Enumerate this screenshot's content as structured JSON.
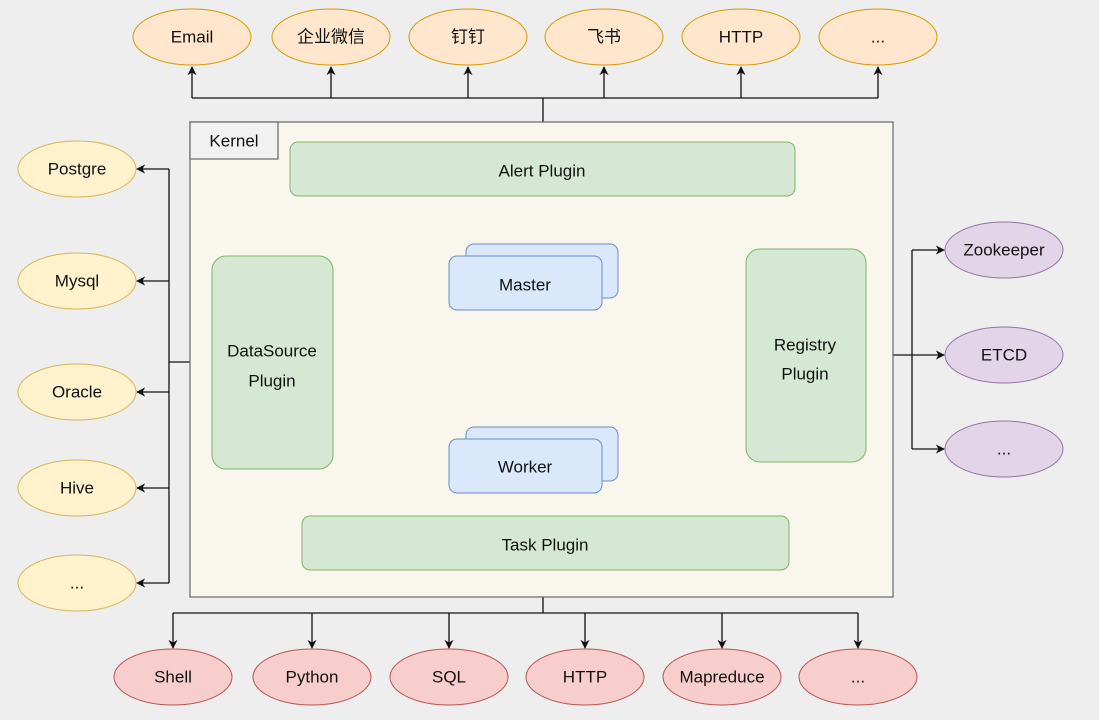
{
  "kernel": {
    "label": "Kernel"
  },
  "plugins": {
    "alert": "Alert Plugin",
    "datasource": [
      "DataSource",
      "Plugin"
    ],
    "registry": [
      "Registry",
      "Plugin"
    ],
    "task": "Task Plugin"
  },
  "nodes": {
    "master": "Master",
    "worker": "Worker"
  },
  "alert_targets": [
    "Email",
    "企业微信",
    "钉钉",
    "飞书",
    "HTTP",
    "..."
  ],
  "datasources": [
    "Postgre",
    "Mysql",
    "Oracle",
    "Hive",
    "..."
  ],
  "registries": [
    "Zookeeper",
    "ETCD",
    "..."
  ],
  "tasks": [
    "Shell",
    "Python",
    "SQL",
    "HTTP",
    "Mapreduce",
    "..."
  ],
  "colors": {
    "background": "#eeeeee",
    "kernel_fill": "#f9f7ed",
    "plugin_fill": "#d5e8d4",
    "plugin_stroke": "#82b366",
    "node_fill": "#dae8fc",
    "node_stroke": "#6c8ebf",
    "alert_fill": "#ffe6cc",
    "alert_stroke": "#d79b00",
    "datasource_fill": "#fff2cc",
    "datasource_stroke": "#d6b656",
    "registry_fill": "#e1d5e7",
    "registry_stroke": "#9673a6",
    "task_fill": "#f8cecc",
    "task_stroke": "#b85450"
  }
}
